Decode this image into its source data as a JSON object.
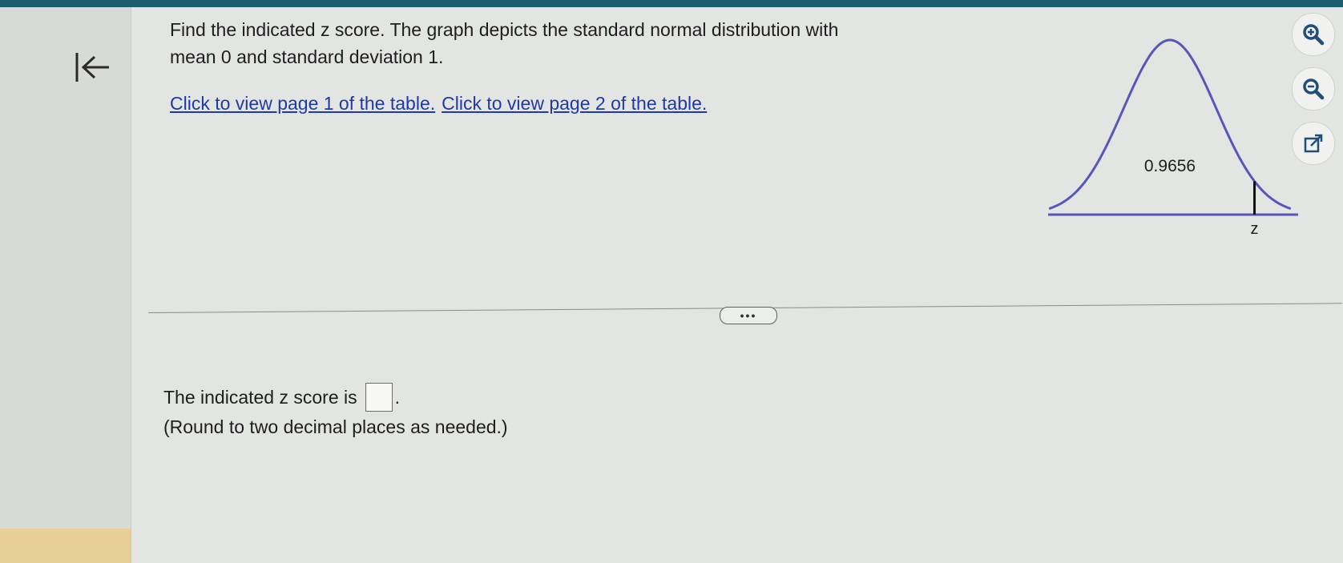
{
  "question": {
    "line1": "Find the indicated z score. The graph depicts the standard normal distribution with",
    "line2": "mean 0 and standard deviation 1."
  },
  "links": {
    "table_page_1": "Click to view page 1 of the table.",
    "table_page_2": "Click to view page 2 of the table."
  },
  "graph": {
    "area_label": "0.9656",
    "z_label": "z",
    "mean": 0,
    "standard_deviation": 1,
    "shaded_area_left_of_z": 0.9656
  },
  "toolbar": {
    "zoom_in_icon": "zoom-in-icon",
    "zoom_out_icon": "zoom-out-icon",
    "popout_icon": "popout-icon"
  },
  "navigation": {
    "back_icon": "first-page-icon"
  },
  "divider": {
    "more_label": "•••"
  },
  "answer": {
    "prefix": "The indicated z score is",
    "value": "",
    "suffix": ".",
    "instruction": "(Round to two decimal places as needed.)"
  },
  "colors": {
    "curve": "#5a55b8",
    "link": "#1f3aa6",
    "header": "#1d5b6e",
    "accent": "#e8cf95"
  }
}
